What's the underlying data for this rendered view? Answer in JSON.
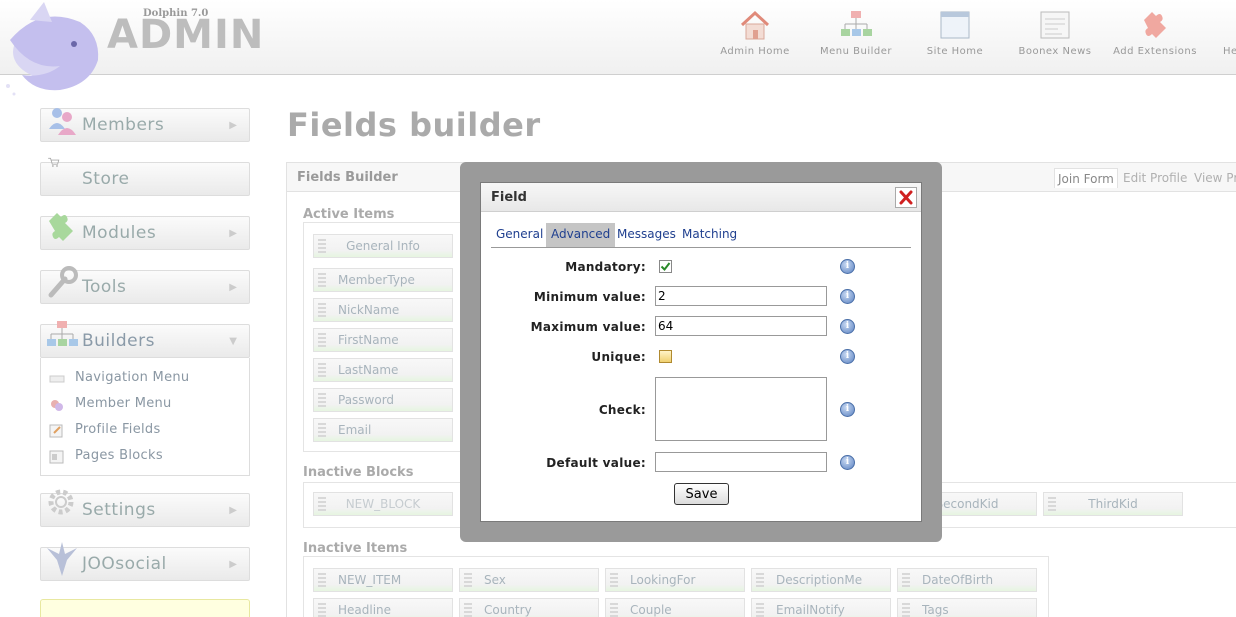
{
  "header": {
    "version": "Dolphin 7.0",
    "logo_text": "ADMIN",
    "nav": [
      {
        "label": "Admin Home",
        "icon": "house-icon"
      },
      {
        "label": "Menu Builder",
        "icon": "sitemap-icon"
      },
      {
        "label": "Site Home",
        "icon": "window-icon"
      },
      {
        "label": "Boonex News",
        "icon": "news-icon"
      },
      {
        "label": "Add Extensions",
        "icon": "puzzle-icon"
      },
      {
        "label": "He",
        "icon": "help-icon"
      }
    ]
  },
  "sidebar": {
    "blocks": [
      {
        "label": "Members",
        "icon": "members-icon"
      },
      {
        "label": "Store",
        "icon": "cart-icon"
      },
      {
        "label": "Modules",
        "icon": "puzzle-icon"
      },
      {
        "label": "Tools",
        "icon": "wrench-icon"
      },
      {
        "label": "Builders",
        "icon": "sitemap-icon"
      },
      {
        "label": "Settings",
        "icon": "gear-icon"
      },
      {
        "label": "JOOsocial",
        "icon": "joosocial-icon"
      }
    ],
    "builders_items": [
      {
        "label": "Navigation Menu",
        "icon": "menu-bar-icon"
      },
      {
        "label": "Member Menu",
        "icon": "member-menu-icon"
      },
      {
        "label": "Profile Fields",
        "icon": "profile-fields-icon"
      },
      {
        "label": "Pages Blocks",
        "icon": "page-blocks-icon"
      }
    ]
  },
  "main": {
    "page_title": "Fields builder",
    "box_title": "Fields Builder",
    "tabs": [
      "Join Form",
      "Edit Profile",
      "View Pr"
    ],
    "active_items_title": "Active Items",
    "active_items": [
      "General Info",
      "MemberType",
      "NickName",
      "FirstName",
      "LastName",
      "Password",
      "Email"
    ],
    "inactive_blocks_title": "Inactive Blocks",
    "inactive_blocks": [
      "NEW_BLOCK",
      "SecondKid",
      "ThirdKid"
    ],
    "inactive_items_title": "Inactive Items",
    "inactive_items_row1": [
      "NEW_ITEM",
      "Sex",
      "LookingFor",
      "DescriptionMe",
      "DateOfBirth"
    ],
    "inactive_items_row2": [
      "Headline",
      "Country",
      "Couple",
      "EmailNotify",
      "Tags"
    ]
  },
  "modal": {
    "title": "Field",
    "tabs": [
      "General",
      "Advanced",
      "Messages",
      "Matching"
    ],
    "active_tab": "Advanced",
    "fields": {
      "mandatory_label": "Mandatory:",
      "mandatory_checked": true,
      "min_label": "Minimum value:",
      "min_value": "2",
      "max_label": "Maximum value:",
      "max_value": "64",
      "unique_label": "Unique:",
      "unique_checked": false,
      "check_label": "Check:",
      "check_value": "",
      "default_label": "Default value:",
      "default_value": ""
    },
    "save_label": "Save"
  }
}
